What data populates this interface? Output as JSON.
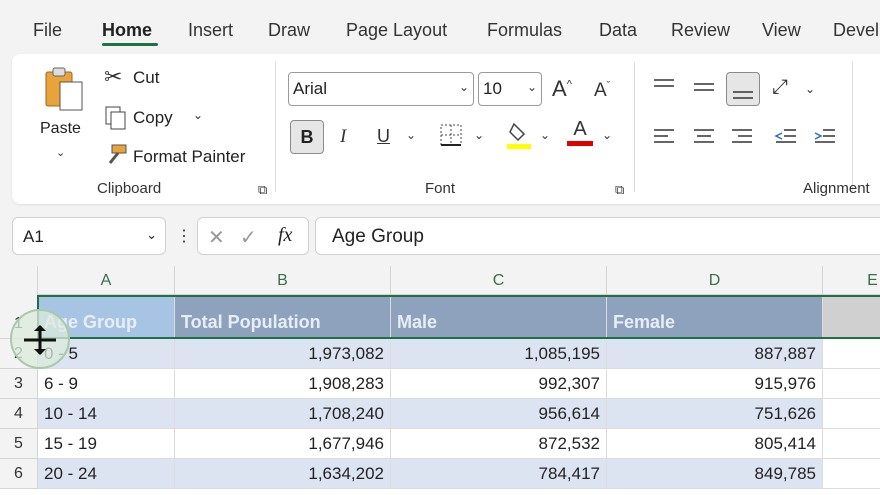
{
  "menu": {
    "tabs": [
      "File",
      "Home",
      "Insert",
      "Draw",
      "Page Layout",
      "Formulas",
      "Data",
      "Review",
      "View",
      "Devel"
    ],
    "active_tab": "Home"
  },
  "ribbon": {
    "clipboard": {
      "paste": "Paste",
      "cut": "Cut",
      "copy": "Copy",
      "format_painter": "Format Painter",
      "label": "Clipboard"
    },
    "font": {
      "font_name": "Arial",
      "font_size": "10",
      "label": "Font",
      "bold": "B",
      "italic": "I",
      "underline": "U",
      "grow": "A",
      "shrink": "A",
      "font_color_letter": "A",
      "highlight_color": "#ffff00",
      "font_color": "#e00000"
    },
    "alignment": {
      "label": "Alignment"
    }
  },
  "formula_bar": {
    "name_box": "A1",
    "fx": "fx",
    "content": "Age Group"
  },
  "grid": {
    "columns": [
      "A",
      "B",
      "C",
      "D",
      "E"
    ],
    "row_numbers": [
      "1",
      "2",
      "3",
      "4",
      "5",
      "6"
    ],
    "header": [
      "Age Group",
      "Total Population",
      "Male",
      "Female"
    ],
    "rows": [
      [
        "0 - 5",
        "1,973,082",
        "1,085,195",
        "887,887"
      ],
      [
        "6 - 9",
        "1,908,283",
        "992,307",
        "915,976"
      ],
      [
        "10 - 14",
        "1,708,240",
        "956,614",
        "751,626"
      ],
      [
        "15 - 19",
        "1,677,946",
        "872,532",
        "805,414"
      ],
      [
        "20 - 24",
        "1,634,202",
        "784,417",
        "849,785"
      ]
    ]
  },
  "colors": {
    "accent": "#1e7145",
    "header_fill": "#8ea2bd",
    "band_fill": "#dce4f2"
  }
}
